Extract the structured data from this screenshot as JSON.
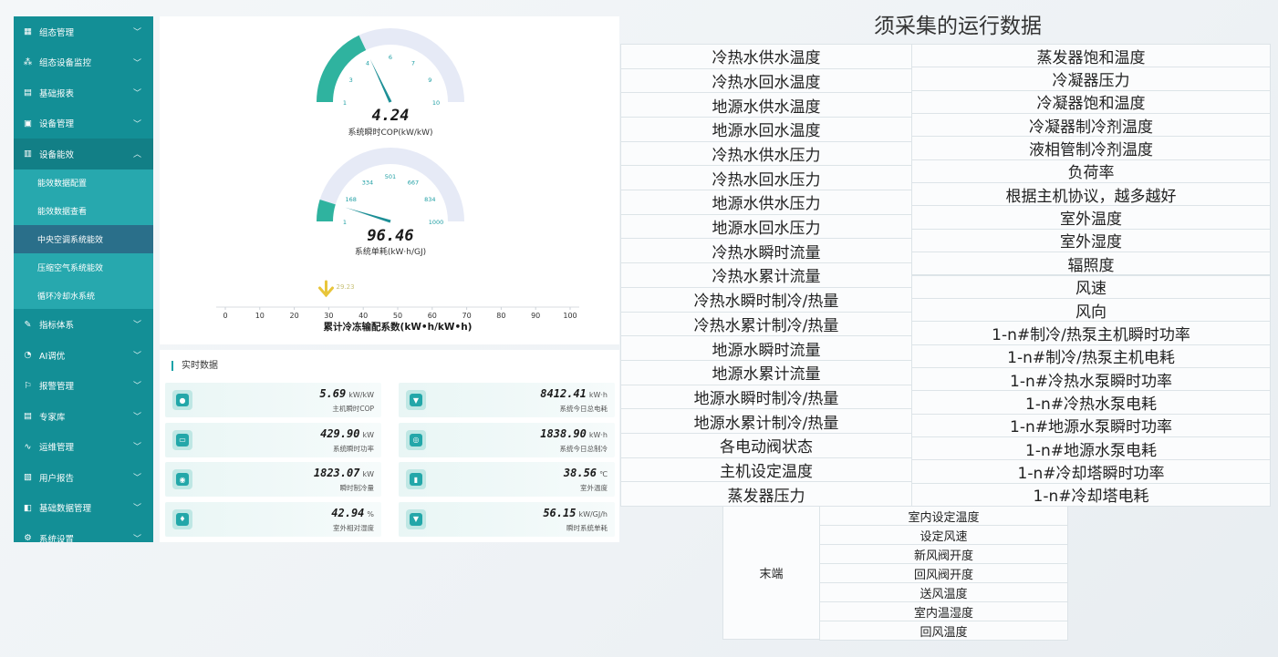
{
  "sidebar": {
    "items": [
      {
        "label": "组态管理",
        "icon": "grid-icon"
      },
      {
        "label": "组态设备监控",
        "icon": "network-icon"
      },
      {
        "label": "基础报表",
        "icon": "report-icon"
      },
      {
        "label": "设备管理",
        "icon": "device-icon"
      },
      {
        "label": "设备能效",
        "icon": "chart-icon",
        "open": true
      }
    ],
    "submenu": [
      {
        "label": "能效数据配置"
      },
      {
        "label": "能效数据查看"
      },
      {
        "label": "中央空调系统能效",
        "active": true
      },
      {
        "label": "压缩空气系统能效"
      },
      {
        "label": "循环冷却水系统"
      }
    ],
    "items_after": [
      {
        "label": "指标体系",
        "icon": "edit-icon"
      },
      {
        "label": "AI调优",
        "icon": "ai-icon"
      },
      {
        "label": "报警管理",
        "icon": "alarm-icon"
      },
      {
        "label": "专家库",
        "icon": "book-icon"
      },
      {
        "label": "运维管理",
        "icon": "pulse-icon"
      },
      {
        "label": "用户报告",
        "icon": "user-report-icon"
      },
      {
        "label": "基础数据管理",
        "icon": "database-icon"
      },
      {
        "label": "系统设置",
        "icon": "settings-icon"
      }
    ]
  },
  "gauge1": {
    "value": "4.24",
    "value_num": 4.24,
    "label": "系统瞬时COP(kW/kW)",
    "min": 1,
    "max": 10,
    "ticks": [
      "1",
      "3",
      "4",
      "6",
      "7",
      "9",
      "10"
    ],
    "fill_color": "#2fb39f"
  },
  "gauge2": {
    "value": "96.46",
    "value_num": 96.46,
    "label": "系统单耗(kW·h/GJ)",
    "min": 1,
    "max": 1000,
    "ticks": [
      "1",
      "168",
      "334",
      "501",
      "667",
      "834",
      "1000"
    ],
    "fill_color": "#2fb39f"
  },
  "linear_scale": {
    "marker": "29.23",
    "marker_value": 29.23,
    "ticks": [
      "0",
      "10",
      "20",
      "30",
      "40",
      "50",
      "60",
      "70",
      "80",
      "90",
      "100"
    ],
    "label": "累计冷冻输配系数(kW•h/kW•h)",
    "marker_color": "#e8c53a"
  },
  "realtime": {
    "title": "实时数据",
    "cards": [
      {
        "value": "5.69",
        "unit": "kW/kW",
        "label": "主机瞬时COP",
        "icon": "cop-icon"
      },
      {
        "value": "8412.41",
        "unit": "kW·h",
        "label": "系统今日总电耗",
        "icon": "power-icon"
      },
      {
        "value": "429.90",
        "unit": "kW",
        "label": "系统瞬时功率",
        "icon": "monitor-icon"
      },
      {
        "value": "1838.90",
        "unit": "kW·h",
        "label": "系统今日总制冷",
        "icon": "cooling-icon"
      },
      {
        "value": "1823.07",
        "unit": "kW",
        "label": "瞬时制冷量",
        "icon": "snow-icon"
      },
      {
        "value": "38.56",
        "unit": "℃",
        "label": "室外温度",
        "icon": "thermometer-icon"
      },
      {
        "value": "42.94",
        "unit": "%",
        "label": "室外相对湿度",
        "icon": "humidity-icon"
      },
      {
        "value": "56.15",
        "unit": "kW/GJ/h",
        "label": "瞬时系统单耗",
        "icon": "energy-icon"
      }
    ]
  },
  "right": {
    "title": "须采集的运行数据",
    "col1": [
      "冷热水供水温度",
      "冷热水回水温度",
      "地源水供水温度",
      "地源水回水温度",
      "冷热水供水压力",
      "冷热水回水压力",
      "地源水供水压力",
      "地源水回水压力",
      "冷热水瞬时流量",
      "冷热水累计流量",
      "冷热水瞬时制冷/热量",
      "冷热水累计制冷/热量",
      "地源水瞬时流量",
      "地源水累计流量",
      "地源水瞬时制冷/热量",
      "地源水累计制冷/热量",
      "各电动阀状态",
      "主机设定温度",
      "蒸发器压力"
    ],
    "col2": [
      "蒸发器饱和温度",
      "冷凝器压力",
      "冷凝器饱和温度",
      "冷凝器制冷剂温度",
      "液相管制冷剂温度",
      "负荷率",
      "根据主机协议，越多越好",
      "室外温度",
      "室外湿度",
      "辐照度",
      "风速",
      "风向",
      "1-n#制冷/热泵主机瞬时功率",
      "1-n#制冷/热泵主机电耗",
      "1-n#冷热水泵瞬时功率",
      "1-n#冷热水泵电耗",
      "1-n#地源水泵瞬时功率",
      "1-n#地源水泵电耗",
      "1-n#冷却塔瞬时功率",
      "1-n#冷却塔电耗"
    ],
    "terminal_label": "末端",
    "terminal_items": [
      "室内设定温度",
      "设定风速",
      "新风阀开度",
      "回风阀开度",
      "送风温度",
      "室内温湿度",
      "回风温度"
    ]
  }
}
